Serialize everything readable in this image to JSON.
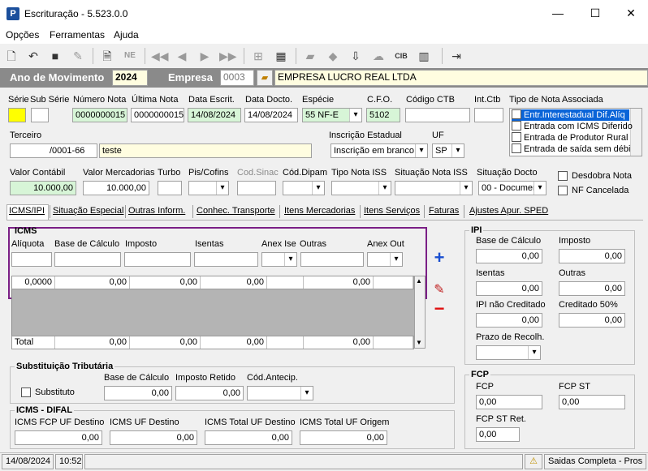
{
  "window": {
    "title": "Escrituração - 5.523.0.0",
    "minimize": "—",
    "maximize": "☐",
    "close": "✕"
  },
  "menu": [
    "Opções",
    "Ferramentas",
    "Ajuda"
  ],
  "toolbar": {
    "icons": [
      "new-icon",
      "undo-icon",
      "save-icon",
      "delete-icon",
      "preview-icon",
      "nfe-icon",
      "first-icon",
      "prev-icon",
      "next-icon",
      "last-icon",
      "tree-icon",
      "calc-icon",
      "folder-icon",
      "import-icon",
      "download-icon",
      "cloud-icon",
      "cib-icon",
      "device-icon",
      "exit-icon"
    ],
    "nfe_text": "NE"
  },
  "yearbar": {
    "ano_label": "Ano de Movimento",
    "ano_value": "2024",
    "empresa_label": "Empresa",
    "empresa_code": "0003",
    "empresa_name": "EMPRESA LUCRO REAL LTDA"
  },
  "fields": {
    "serie_label": "Série",
    "sub_serie_label": "Sub Série",
    "numero_nota_label": "Número Nota",
    "numero_nota": "0000000015",
    "ultima_nota_label": "Última Nota",
    "ultima_nota": "0000000015",
    "data_escrit_label": "Data Escrit.",
    "data_escrit": "14/08/2024",
    "data_docto_label": "Data Docto.",
    "data_docto": "14/08/2024",
    "especie_label": "Espécie",
    "especie": "55  NF-E",
    "cfo_label": "C.F.O.",
    "cfo": "5102",
    "codigo_ctb_label": "Código CTB",
    "int_ctb_label": "Int.Ctb",
    "tipo_nota_label": "Tipo de Nota Associada",
    "tipo_nota_items": [
      "Entr.Interestadual Dif.Alíq",
      "Entrada com ICMS Diferido",
      "Entrada de Produtor Rural",
      "Entrada de saída sem débi"
    ],
    "terceiro_label": "Terceiro",
    "terceiro_doc": "/0001-66",
    "terceiro_name": "teste",
    "inscricao_label": "Inscrição Estadual",
    "inscricao": "Inscrição em branco",
    "uf_label": "UF",
    "uf": "SP",
    "valor_contabil_label": "Valor Contábil",
    "valor_contabil": "10.000,00",
    "valor_merc_label": "Valor Mercadorias",
    "valor_merc": "10.000,00",
    "turbo_label": "Turbo",
    "pis_label": "Pis/Cofins",
    "cod_sinac_label": "Cod.Sinac",
    "cod_dipam_label": "Cód.Dipam",
    "tipo_iss_label": "Tipo Nota ISS",
    "situacao_iss_label": "Situação Nota ISS",
    "situacao_docto_label": "Situação Docto",
    "situacao_docto": "00 - Documen",
    "desdobra_label": "Desdobra Nota",
    "nf_cancelada_label": "NF Cancelada"
  },
  "tabs": [
    "ICMS/IPI",
    "Situação Especial",
    "Outras Inform.",
    "Conhec. Transporte",
    "Itens Mercadorias",
    "Itens Serviços",
    "Faturas",
    "Ajustes Apur. SPED"
  ],
  "icms": {
    "title": "ICMS",
    "labels": [
      "Alíquota",
      "Base de Cálculo",
      "Imposto",
      "Isentas",
      "Anex Ise",
      "Outras",
      "Anex Out"
    ],
    "row": [
      "0,0000",
      "0,00",
      "0,00",
      "0,00",
      "",
      "0,00",
      ""
    ],
    "total_label": "Total",
    "total": [
      "0,00",
      "0,00",
      "0,00",
      "",
      "0,00",
      ""
    ],
    "add": "+",
    "remove": "−"
  },
  "ipi": {
    "title": "IPI",
    "base_label": "Base de Cálculo",
    "base": "0,00",
    "imposto_label": "Imposto",
    "imposto": "0,00",
    "isentas_label": "Isentas",
    "isentas": "0,00",
    "outras_label": "Outras",
    "outras": "0,00",
    "nao_cred_label": "IPI não Creditado",
    "nao_cred": "0,00",
    "cred50_label": "Creditado 50%",
    "cred50": "0,00",
    "prazo_label": "Prazo de Recolh."
  },
  "st": {
    "title": "Substituição Tributária",
    "substituto_label": "Substituto",
    "base_label": "Base de Cálculo",
    "base": "0,00",
    "retido_label": "Imposto Retido",
    "retido": "0,00",
    "antecip_label": "Cód.Antecip."
  },
  "fcp": {
    "title": "FCP",
    "fcp_label": "FCP",
    "fcp": "0,00",
    "fcp_st_label": "FCP ST",
    "fcp_st": "0,00",
    "fcp_st_ret_label": "FCP ST Ret.",
    "fcp_st_ret": "0,00"
  },
  "difal": {
    "title": "ICMS - DIFAL",
    "fcp_dest_label": "ICMS FCP UF Destino",
    "fcp_dest": "0,00",
    "uf_dest_label": "ICMS UF Destino",
    "uf_dest": "0,00",
    "total_dest_label": "ICMS Total UF Destino",
    "total_dest": "0,00",
    "total_orig_label": "ICMS Total UF Origem",
    "total_orig": "0,00"
  },
  "status": {
    "date": "14/08/2024",
    "time": "10:52",
    "message": "Saidas Completa - Pros"
  },
  "colors": {
    "highlight": "#7b1f86",
    "yellow": "#ffff00",
    "green": "#d7f5d7"
  }
}
